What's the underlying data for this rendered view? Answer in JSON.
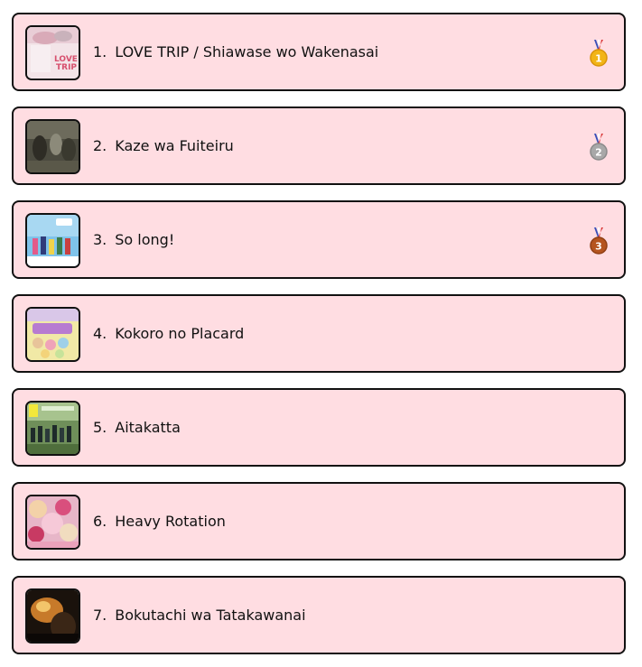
{
  "songs": [
    {
      "rank": "1.",
      "title": "LOVE TRIP / Shiawase wo Wakenasai",
      "medal": "gold-medal-icon",
      "medal_number": "1",
      "cover_text_1": "LOVE",
      "cover_text_2": "TRIP"
    },
    {
      "rank": "2.",
      "title": "Kaze wa Fuiteiru",
      "medal": "silver-medal-icon",
      "medal_number": "2"
    },
    {
      "rank": "3.",
      "title": "So long!",
      "medal": "bronze-medal-icon",
      "medal_number": "3"
    },
    {
      "rank": "4.",
      "title": "Kokoro no Placard"
    },
    {
      "rank": "5.",
      "title": "Aitakatta"
    },
    {
      "rank": "6.",
      "title": "Heavy Rotation"
    },
    {
      "rank": "7.",
      "title": "Bokutachi wa Tatakawanai"
    }
  ],
  "colors": {
    "card_background": "#ffdde2",
    "card_border": "#111111",
    "gold": "#f2b416",
    "silver": "#a8a8a8",
    "bronze": "#b5541f"
  }
}
